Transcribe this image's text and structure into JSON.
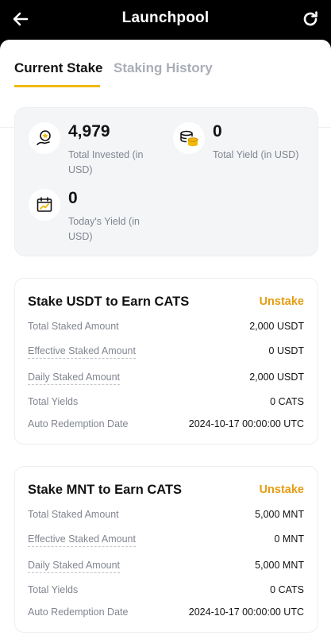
{
  "header": {
    "title": "Launchpool",
    "back_icon": "arrow-left-icon",
    "refresh_icon": "refresh-icon"
  },
  "tabs": [
    {
      "label": "Current Stake",
      "active": true
    },
    {
      "label": "Staking History",
      "active": false
    }
  ],
  "summary": {
    "total_invested": {
      "value": "4,979",
      "label": "Total Invested (in USD)",
      "icon": "hand-coin-icon"
    },
    "total_yield": {
      "value": "0",
      "label": "Total Yield (in USD)",
      "icon": "coin-stack-icon"
    },
    "todays_yield": {
      "value": "0",
      "label": "Today's Yield (in USD)",
      "icon": "calendar-chart-icon"
    }
  },
  "cards": [
    {
      "title": "Stake USDT to Earn CATS",
      "action": "Unstake",
      "rows": [
        {
          "label": "Total Staked Amount",
          "value": "2,000 USDT"
        },
        {
          "label": "Effective Staked Amount",
          "value": "0 USDT"
        },
        {
          "label": "Daily Staked Amount",
          "value": "2,000 USDT"
        },
        {
          "label": "Total Yields",
          "value": "0 CATS"
        },
        {
          "label": "Auto Redemption Date",
          "value": "2024-10-17 00:00:00 UTC"
        }
      ]
    },
    {
      "title": "Stake MNT to Earn CATS",
      "action": "Unstake",
      "rows": [
        {
          "label": "Total Staked Amount",
          "value": "5,000 MNT"
        },
        {
          "label": "Effective Staked Amount",
          "value": "0 MNT"
        },
        {
          "label": "Daily Staked Amount",
          "value": "5,000 MNT"
        },
        {
          "label": "Total Yields",
          "value": "0 CATS"
        },
        {
          "label": "Auto Redemption Date",
          "value": "2024-10-17 00:00:00 UTC"
        }
      ]
    }
  ],
  "colors": {
    "accent": "#f0b90b",
    "action": "#e59c12"
  }
}
